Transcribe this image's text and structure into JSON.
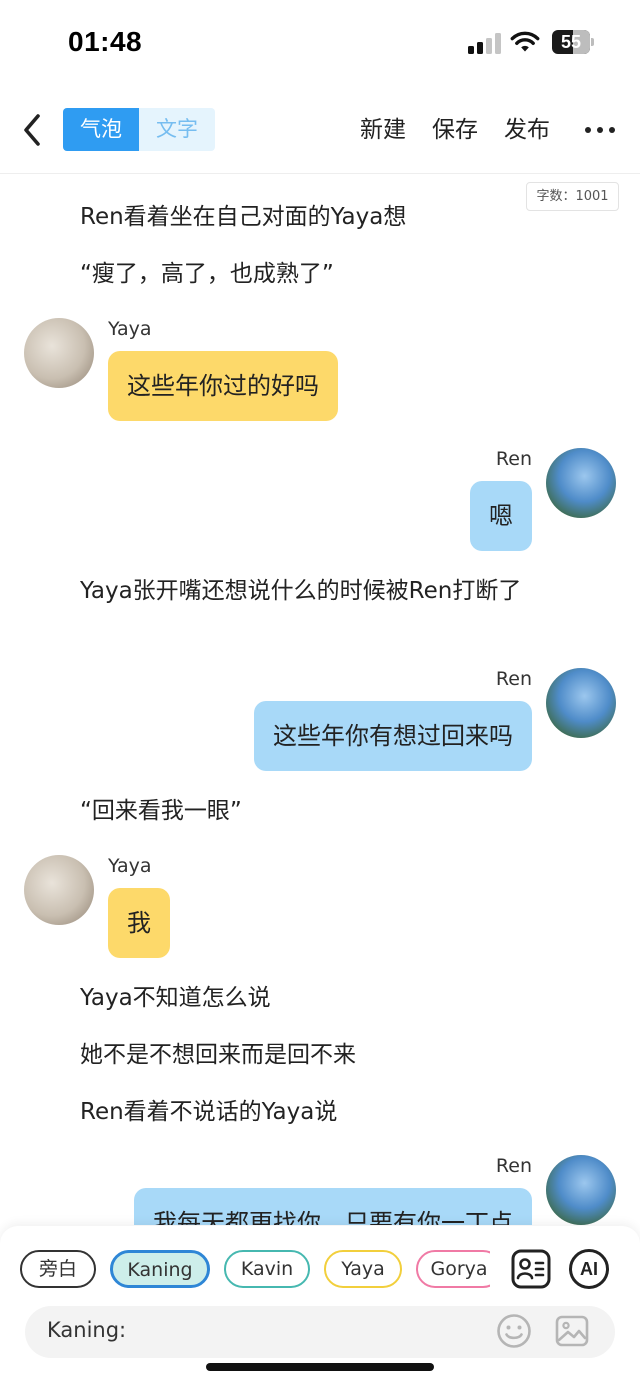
{
  "status_bar": {
    "time": "01:48",
    "battery": "55",
    "battery_level": 0.55
  },
  "nav": {
    "back_icon": "chevron-left-icon",
    "tabs": [
      {
        "label": "气泡",
        "active": true
      },
      {
        "label": "文字",
        "active": false
      }
    ],
    "actions": [
      "新建",
      "保存",
      "发布"
    ],
    "more_icon": "more-icon"
  },
  "word_count": "字数：1001",
  "story": {
    "n1": "Ren看着坐在自己对面的Yaya想",
    "n2": "“瘦了，高了，也成熟了”",
    "m1": {
      "speaker": "Yaya",
      "text": "这些年你过的好吗"
    },
    "m2": {
      "speaker": "Ren",
      "text": "嗯"
    },
    "n3": "Yaya张开嘴还想说什么的时候被Ren打断了",
    "m3": {
      "speaker": "Ren",
      "text": "这些年你有想过回来吗"
    },
    "n4": "“回来看我一眼”",
    "m4": {
      "speaker": "Yaya",
      "text": "我"
    },
    "n5": "Yaya不知道怎么说",
    "n6": "她不是不想回来而是回不来",
    "n7": "Ren看着不说话的Yaya说",
    "m5": {
      "speaker": "Ren",
      "text": "我每天都更找你，只要有你一丁点"
    }
  },
  "characters": [
    {
      "label": "旁白",
      "color": "#333333",
      "bg": "#ffffff",
      "width": 76
    },
    {
      "label": "Kaning",
      "color": "#2e86d6",
      "bg": "#cdeeea",
      "width": 100,
      "selected": true
    },
    {
      "label": "Kavin",
      "color": "#46b8b0",
      "bg": "#ffffff",
      "width": 86
    },
    {
      "label": "Yaya",
      "color": "#f2cf3c",
      "bg": "#ffffff",
      "width": 78
    },
    {
      "label": "Gorya",
      "color": "#f07aa5",
      "bg": "#ffffff",
      "width": 86
    }
  ],
  "tools": {
    "contacts_icon": "contact-card-icon",
    "ai_label": "AI"
  },
  "input": {
    "label": "Kaning:",
    "emoji_icon": "emoji-icon",
    "image_icon": "image-icon"
  }
}
